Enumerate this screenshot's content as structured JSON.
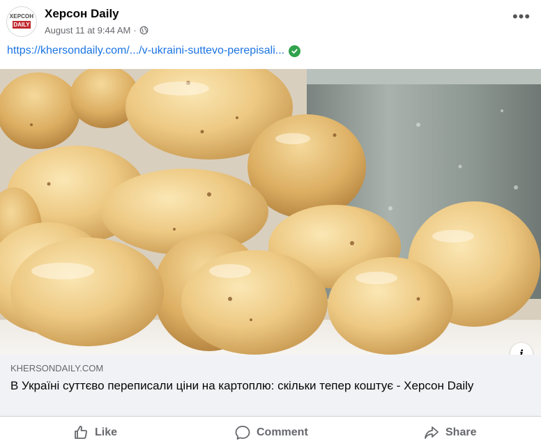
{
  "post": {
    "page_name": "Херсон Daily",
    "date": "August 11 at 9:44 AM",
    "separator": "·",
    "avatar_top": "ХЕРСОН",
    "avatar_bottom": "DAILY",
    "link_text": "https://khersondaily.com/.../v-ukraini-suttevo-perepisali..."
  },
  "preview": {
    "domain": "KHERSONDAILY.COM",
    "title": "В Україні суттєво переписали ціни на картоплю: скільки тепер коштує - Херсон Daily",
    "info_glyph": "i"
  },
  "actions": {
    "like": "Like",
    "comment": "Comment",
    "share": "Share"
  },
  "icons": {
    "more": "more-options-icon",
    "globe": "globe-icon",
    "verified": "verified-check-icon",
    "like": "thumbs-up-icon",
    "comment": "comment-bubble-icon",
    "share": "share-arrow-icon"
  },
  "colors": {
    "link": "#1b74e4",
    "verified": "#31a24c",
    "muted": "#65676b",
    "preview_bg": "#f0f2f5"
  }
}
